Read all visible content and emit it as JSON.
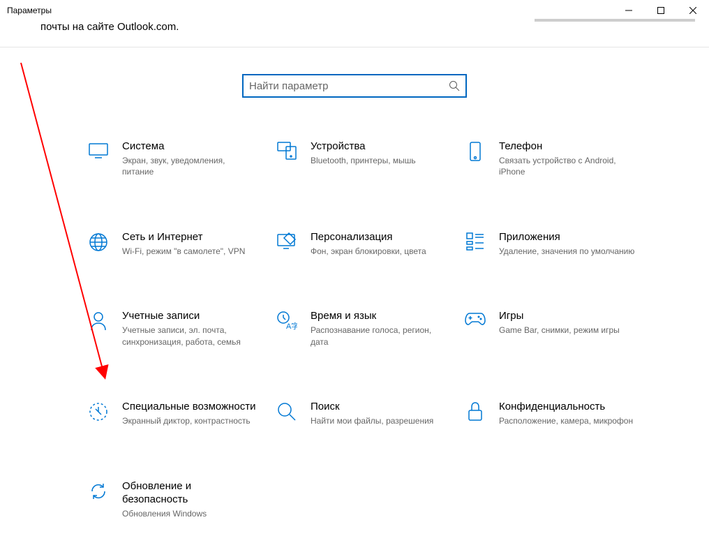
{
  "window": {
    "title": "Параметры"
  },
  "subtitle": "почты на сайте Outlook.com.",
  "search": {
    "placeholder": "Найти параметр"
  },
  "tiles": [
    {
      "title": "Система",
      "desc": "Экран, звук, уведомления, питание"
    },
    {
      "title": "Устройства",
      "desc": "Bluetooth, принтеры, мышь"
    },
    {
      "title": "Телефон",
      "desc": "Связать устройство с Android, iPhone"
    },
    {
      "title": "Сеть и Интернет",
      "desc": "Wi-Fi, режим \"в самолете\", VPN"
    },
    {
      "title": "Персонализация",
      "desc": "Фон, экран блокировки, цвета"
    },
    {
      "title": "Приложения",
      "desc": "Удаление, значения по умолчанию"
    },
    {
      "title": "Учетные записи",
      "desc": "Учетные записи, эл. почта, синхронизация, работа, семья"
    },
    {
      "title": "Время и язык",
      "desc": "Распознавание голоса, регион, дата"
    },
    {
      "title": "Игры",
      "desc": "Game Bar, снимки, режим игры"
    },
    {
      "title": "Специальные возможности",
      "desc": "Экранный диктор, контрастность"
    },
    {
      "title": "Поиск",
      "desc": "Найти мои файлы, разрешения"
    },
    {
      "title": "Конфиденциальность",
      "desc": "Расположение, камера, микрофон"
    },
    {
      "title": "Обновление и безопасность",
      "desc": "Обновления Windows"
    }
  ],
  "colors": {
    "accent": "#0078d4",
    "annotation": "#ff0000"
  }
}
